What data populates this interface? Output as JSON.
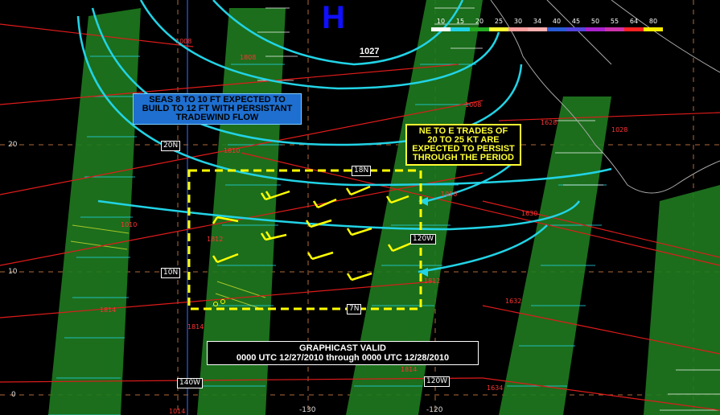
{
  "title_box": {
    "line1": "GRAPHICAST VALID",
    "line2": "0000 UTC 12/27/2010 through 0000 UTC 12/28/2010"
  },
  "high": {
    "symbol": "H",
    "pressure": "1027"
  },
  "notes": {
    "seas": [
      "SEAS 8 TO 10 FT EXPECTED TO",
      "BUILD TO 12 FT WITH PERSISTANT",
      "TRADEWIND FLOW"
    ],
    "trades": [
      "NE TO E TRADES OF",
      "20 TO 25 KT ARE",
      "EXPECTED TO PERSIST",
      "THROUGH THE PERIOD"
    ]
  },
  "legend": {
    "labels": [
      "10",
      "15",
      "20",
      "25",
      "30",
      "34",
      "40",
      "45",
      "50",
      "55",
      "64",
      "80"
    ],
    "colors": [
      "#ffffff",
      "#22d3e6",
      "#22aa22",
      "#ffff33",
      "#ff9f9f",
      "#ffb0b0",
      "#2a5bd6",
      "#5544dd",
      "#aa22cc",
      "#cc33aa",
      "#ff2222",
      "#ffee00"
    ]
  },
  "grid": {
    "lat_labels": [
      "20",
      "10",
      "0"
    ],
    "lon_labels": [
      "-130",
      "-120"
    ]
  },
  "box_labels": {
    "lat_top": "18N",
    "lat_bottom": "7N",
    "lon_right": "120W"
  },
  "coord_boxes": {
    "lat20": "20N",
    "lat10": "10N",
    "lon140": "140W",
    "lon120": "120W"
  },
  "isobars": [
    {
      "label": "1008"
    },
    {
      "label": "1808"
    },
    {
      "label": "1008"
    },
    {
      "label": "1010"
    },
    {
      "label": "1810"
    },
    {
      "label": "1812"
    },
    {
      "label": "1812"
    },
    {
      "label": "1814"
    },
    {
      "label": "1814"
    },
    {
      "label": "1814"
    },
    {
      "label": "1630"
    },
    {
      "label": "1632"
    },
    {
      "label": "1634"
    },
    {
      "label": "1010"
    },
    {
      "label": "1628"
    },
    {
      "label": "1028"
    },
    {
      "label": "1014"
    }
  ]
}
